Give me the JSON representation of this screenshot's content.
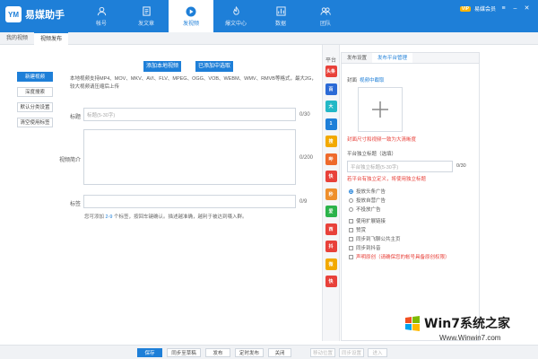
{
  "app": {
    "title": "易媒助手",
    "logo_mark": "YM"
  },
  "nav": [
    {
      "label": "帐号",
      "icon": "user-icon"
    },
    {
      "label": "发文章",
      "icon": "document-icon"
    },
    {
      "label": "发视频",
      "icon": "play-icon"
    },
    {
      "label": "爆文中心",
      "icon": "fire-icon"
    },
    {
      "label": "数据",
      "icon": "chart-icon"
    },
    {
      "label": "团队",
      "icon": "team-icon"
    }
  ],
  "topbar": {
    "vip": "VIP",
    "user": "易媒会员"
  },
  "subtabs": [
    "我的视频",
    "视频发布"
  ],
  "leftmenu": [
    "新建视频",
    "深度搜索",
    "默认分类设置",
    "清空使用标签"
  ],
  "main": {
    "add_local_btn": "添加本地视频",
    "add_existing_btn": "已添加中选取",
    "desc": "本地视频支持MP4、MOV、MKV、AVI、FLV、MPEG、OGG、VOB、WEBM、WMV、RMVB等格式，最大2G，较大视频请压缩后上传",
    "title_label": "标题",
    "title_placeholder": "标题(5-30字)",
    "title_count": "0/30",
    "intro_label": "视频简介",
    "intro_count": "0/200",
    "tags_label": "标签",
    "tags_count": "0/9",
    "tags_hint_pre": "您可添加",
    "tags_hint_num": "2-9",
    "tags_hint_post": "个标签，按回车键确认。描述越准确，越利于被达到嗫入群。"
  },
  "platform": {
    "header": "平台",
    "icons": [
      {
        "name": "toutiao-icon",
        "label": "头条",
        "color": "#e8413a"
      },
      {
        "name": "baijia-icon",
        "label": "百",
        "color": "#2b6ad6"
      },
      {
        "name": "dayu-icon",
        "label": "大",
        "color": "#23b8c6"
      },
      {
        "name": "one-icon",
        "label": "1",
        "color": "#1e7fd8"
      },
      {
        "name": "sohu-icon",
        "label": "搜",
        "color": "#f2a900"
      },
      {
        "name": "bilibili-icon",
        "label": "哔",
        "color": "#ee6a2c"
      },
      {
        "name": "kuaibao-icon",
        "label": "快",
        "color": "#e8413a"
      },
      {
        "name": "miaopai-icon",
        "label": "秒",
        "color": "#ee8f2c"
      },
      {
        "name": "iqiyi-icon",
        "label": "爱",
        "color": "#2bb34a"
      },
      {
        "name": "xigua-icon",
        "label": "西",
        "color": "#e8413a"
      },
      {
        "name": "douyin-icon",
        "label": "抖",
        "color": "#e8413a"
      },
      {
        "name": "weibo-icon",
        "label": "微",
        "color": "#f2a900"
      },
      {
        "name": "kuai-icon",
        "label": "快",
        "color": "#e8413a"
      }
    ]
  },
  "right": {
    "tabs": [
      "发布设置",
      "发布平台管理"
    ],
    "cover_label": "封面",
    "cover_link": "视频中截取",
    "cover_note": "封面尺寸和视频一致为大清晰度",
    "platform_title_label": "平台独立标题（选填）",
    "platform_title_placeholder": "平台独立标题(5-30字)",
    "platform_title_count": "0/30",
    "platform_title_note": "若平台有独立定义，将使用独立标题",
    "ad_options": [
      "投放头条广告",
      "投放自营广告",
      "不投放广告"
    ],
    "checks": [
      "使用扩展链接",
      "赞赏",
      "同步到飞聊公共主页",
      "同步到抖音",
      "声明原创（请确保您的帐号具备原创权限）"
    ]
  },
  "bottom": [
    "保存",
    "同步至草稿",
    "发布",
    "定时发布",
    "关闭",
    "移动位置",
    "同步设置",
    "进入"
  ],
  "watermark": {
    "logo": "Win7系统之家",
    "url": "Www.Winwin7.com"
  }
}
